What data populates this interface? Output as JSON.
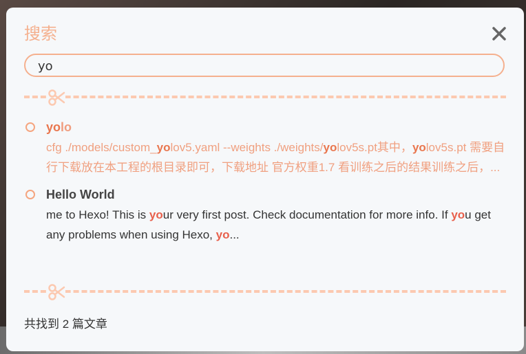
{
  "dialog": {
    "title": "搜索",
    "close_icon": "close-icon"
  },
  "search": {
    "query": "yo"
  },
  "results": [
    {
      "title_match": "yo",
      "title_rest": "lo",
      "snippet_parts": [
        {
          "t": "cfg ./models/custom_",
          "hl": false
        },
        {
          "t": "yo",
          "hl": true
        },
        {
          "t": "lov5.yaml --weights ./weights/",
          "hl": false
        },
        {
          "t": "yo",
          "hl": true
        },
        {
          "t": "lov5s.pt其中，",
          "hl": false
        },
        {
          "t": "yo",
          "hl": true
        },
        {
          "t": "lov5s.pt 需要自行下载放在本工程的根目录即可，下载地址 官方权重1.7 看训练之后的结果训练之后，...",
          "hl": false
        }
      ]
    },
    {
      "title": "Hello World",
      "snippet_parts": [
        {
          "t": "me to Hexo! This is ",
          "hl": false
        },
        {
          "t": "yo",
          "hl": true
        },
        {
          "t": "ur very first post. Check documentation for more info. If ",
          "hl": false
        },
        {
          "t": "yo",
          "hl": true
        },
        {
          "t": "u get any problems when using Hexo, ",
          "hl": false
        },
        {
          "t": "yo",
          "hl": true
        },
        {
          "t": "...",
          "hl": false
        }
      ]
    }
  ],
  "footer": {
    "summary": "共找到 2 篇文章"
  },
  "colors": {
    "accent": "#f5b08e",
    "highlight": "#e9764e",
    "divider": "#fcc9b0"
  }
}
